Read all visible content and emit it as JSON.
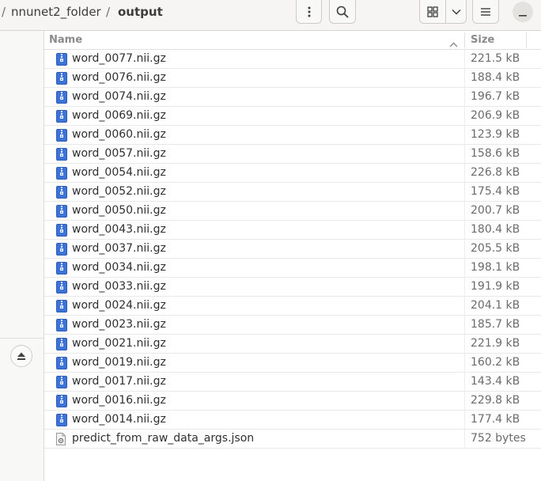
{
  "breadcrumb": {
    "separator": "/",
    "parent": "nnunet2_folder",
    "current": "output"
  },
  "toolbar": {
    "menu_icon": "vertical-dots-icon",
    "search_icon": "search-icon",
    "view_icon": "grid-view-icon",
    "view_dropdown_icon": "chevron-down-icon",
    "hamburger_icon": "hamburger-menu-icon",
    "minimize_icon": "minimize-icon"
  },
  "sidebar": {
    "eject_icon": "eject-icon"
  },
  "columns": {
    "name": "Name",
    "size": "Size"
  },
  "files": [
    {
      "name": "word_0077.nii.gz",
      "size": "221.5 kB",
      "icon": "archive-file-icon"
    },
    {
      "name": "word_0076.nii.gz",
      "size": "188.4 kB",
      "icon": "archive-file-icon"
    },
    {
      "name": "word_0074.nii.gz",
      "size": "196.7 kB",
      "icon": "archive-file-icon"
    },
    {
      "name": "word_0069.nii.gz",
      "size": "206.9 kB",
      "icon": "archive-file-icon"
    },
    {
      "name": "word_0060.nii.gz",
      "size": "123.9 kB",
      "icon": "archive-file-icon"
    },
    {
      "name": "word_0057.nii.gz",
      "size": "158.6 kB",
      "icon": "archive-file-icon"
    },
    {
      "name": "word_0054.nii.gz",
      "size": "226.8 kB",
      "icon": "archive-file-icon"
    },
    {
      "name": "word_0052.nii.gz",
      "size": "175.4 kB",
      "icon": "archive-file-icon"
    },
    {
      "name": "word_0050.nii.gz",
      "size": "200.7 kB",
      "icon": "archive-file-icon"
    },
    {
      "name": "word_0043.nii.gz",
      "size": "180.4 kB",
      "icon": "archive-file-icon"
    },
    {
      "name": "word_0037.nii.gz",
      "size": "205.5 kB",
      "icon": "archive-file-icon"
    },
    {
      "name": "word_0034.nii.gz",
      "size": "198.1 kB",
      "icon": "archive-file-icon"
    },
    {
      "name": "word_0033.nii.gz",
      "size": "191.9 kB",
      "icon": "archive-file-icon"
    },
    {
      "name": "word_0024.nii.gz",
      "size": "204.1 kB",
      "icon": "archive-file-icon"
    },
    {
      "name": "word_0023.nii.gz",
      "size": "185.7 kB",
      "icon": "archive-file-icon"
    },
    {
      "name": "word_0021.nii.gz",
      "size": "221.9 kB",
      "icon": "archive-file-icon"
    },
    {
      "name": "word_0019.nii.gz",
      "size": "160.2 kB",
      "icon": "archive-file-icon"
    },
    {
      "name": "word_0017.nii.gz",
      "size": "143.4 kB",
      "icon": "archive-file-icon"
    },
    {
      "name": "word_0016.nii.gz",
      "size": "229.8 kB",
      "icon": "archive-file-icon"
    },
    {
      "name": "word_0014.nii.gz",
      "size": "177.4 kB",
      "icon": "archive-file-icon"
    },
    {
      "name": "predict_from_raw_data_args.json",
      "size": "752 bytes",
      "icon": "json-file-icon"
    }
  ],
  "colors": {
    "archive_icon": "#3d72d6",
    "headerbar_bg": "#f6f5f4"
  }
}
